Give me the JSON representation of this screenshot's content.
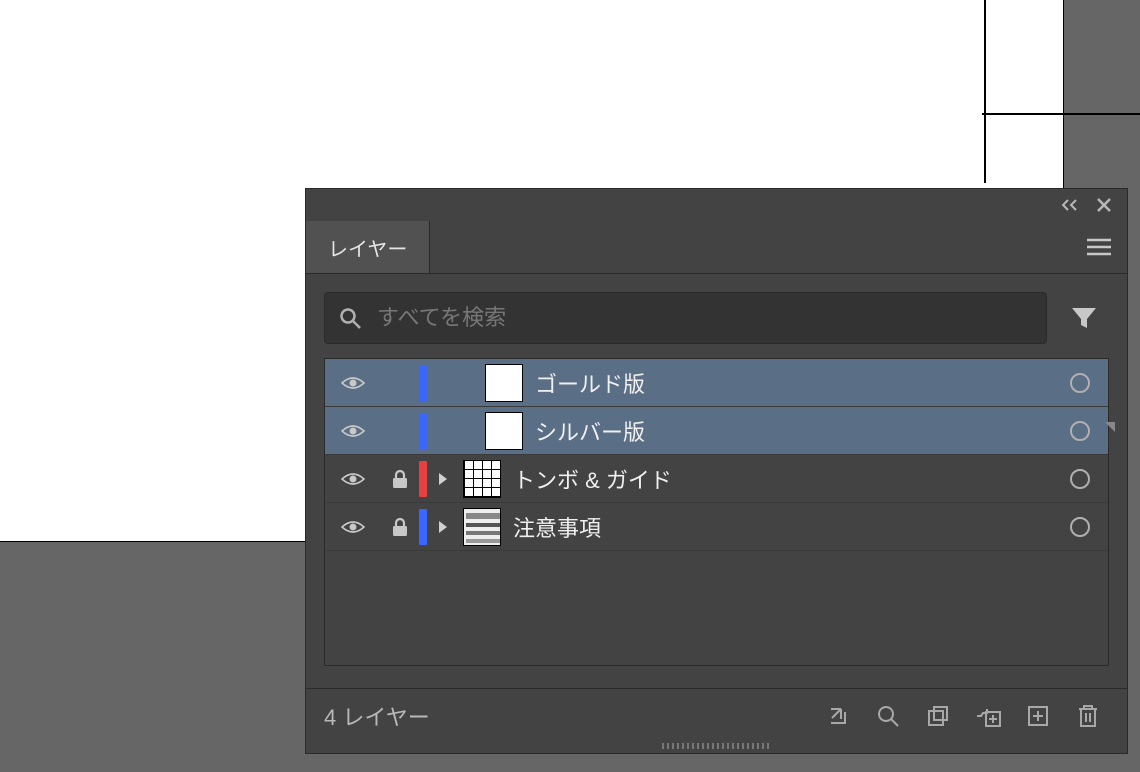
{
  "panel": {
    "tab_label": "レイヤー",
    "search_placeholder": "すべてを検索",
    "footer_status": "4 レイヤー"
  },
  "layers": [
    {
      "name": "ゴールド版",
      "color": "#3a66ff",
      "selected": true,
      "locked": false,
      "has_children": false,
      "thumb": "blank"
    },
    {
      "name": "シルバー版",
      "color": "#3a66ff",
      "selected": true,
      "locked": false,
      "has_children": false,
      "thumb": "blank"
    },
    {
      "name": "トンボ & ガイド",
      "color": "#e74040",
      "selected": false,
      "locked": true,
      "has_children": true,
      "thumb": "guides"
    },
    {
      "name": "注意事項",
      "color": "#3a66ff",
      "selected": false,
      "locked": true,
      "has_children": true,
      "thumb": "notes"
    }
  ]
}
